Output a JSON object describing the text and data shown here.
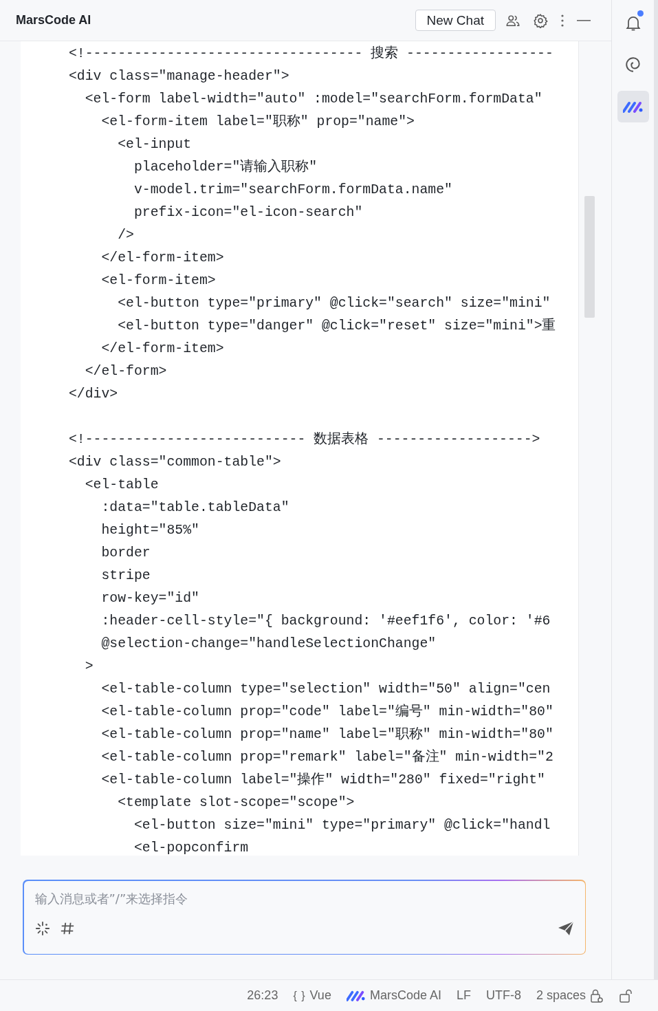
{
  "header": {
    "title": "MarsCode AI",
    "new_chat": "New Chat"
  },
  "sidebar": {
    "items": [
      {
        "selected": false,
        "badge": true
      },
      {
        "selected": false,
        "badge": false
      },
      {
        "selected": true,
        "badge": false
      }
    ]
  },
  "code": {
    "blocks": [
      {
        "lines": [
          "<!---------------------------------- 搜索 ------------------",
          "<div class=\"manage-header\">",
          "  <el-form label-width=\"auto\" :model=\"searchForm.formData\"",
          "    <el-form-item label=\"职称\" prop=\"name\">",
          "      <el-input",
          "        placeholder=\"请输入职称\"",
          "        v-model.trim=\"searchForm.formData.name\"",
          "        prefix-icon=\"el-icon-search\"",
          "      />",
          "    </el-form-item>",
          "    <el-form-item>",
          "      <el-button type=\"primary\" @click=\"search\" size=\"mini\"",
          "      <el-button type=\"danger\" @click=\"reset\" size=\"mini\">重",
          "    </el-form-item>",
          "  </el-form>",
          "</div>"
        ]
      },
      {
        "lines": [
          "<!--------------------------- 数据表格 ------------------->",
          "<div class=\"common-table\">",
          "  <el-table",
          "    :data=\"table.tableData\"",
          "    height=\"85%\"",
          "    border",
          "    stripe",
          "    row-key=\"id\"",
          "    :header-cell-style=\"{ background: '#eef1f6', color: '#6",
          "    @selection-change=\"handleSelectionChange\"",
          "  >",
          "    <el-table-column type=\"selection\" width=\"50\" align=\"cen",
          "    <el-table-column prop=\"code\" label=\"编号\" min-width=\"80\"",
          "    <el-table-column prop=\"name\" label=\"职称\" min-width=\"80\"",
          "    <el-table-column prop=\"remark\" label=\"备注\" min-width=\"2",
          "    <el-table-column label=\"操作\" width=\"280\" fixed=\"right\"",
          "      <template slot-scope=\"scope\">",
          "        <el-button size=\"mini\" type=\"primary\" @click=\"handl",
          "        <el-popconfirm"
        ]
      }
    ]
  },
  "input": {
    "placeholder": "输入消息或者”/”来选择指令"
  },
  "status_bar": {
    "position": "26:23",
    "language_icon": "{ }",
    "language": "Vue",
    "plugin": "MarsCode AI",
    "line_ending": "LF",
    "encoding": "UTF-8",
    "indent": "2 spaces"
  }
}
